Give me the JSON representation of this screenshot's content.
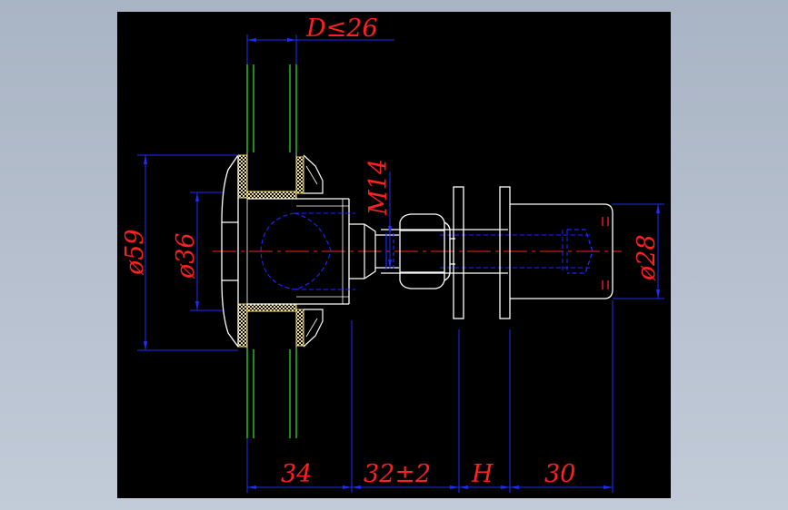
{
  "colors": {
    "dimension": "#1f2cff",
    "dimension_text": "#ff2020",
    "outline": "#ffffff",
    "hidden": "#1a2bff",
    "glass": "#2bd92b",
    "gasket": "#f2e07a",
    "centerline": "#ff2020"
  },
  "dimensions": {
    "d_max": "D≤26",
    "dia_59": "ø59",
    "dia_36": "ø36",
    "thread": "M14",
    "dia_28": "ø28",
    "len_34": "34",
    "len_32": "32±2",
    "len_h": "H",
    "len_30": "30"
  }
}
